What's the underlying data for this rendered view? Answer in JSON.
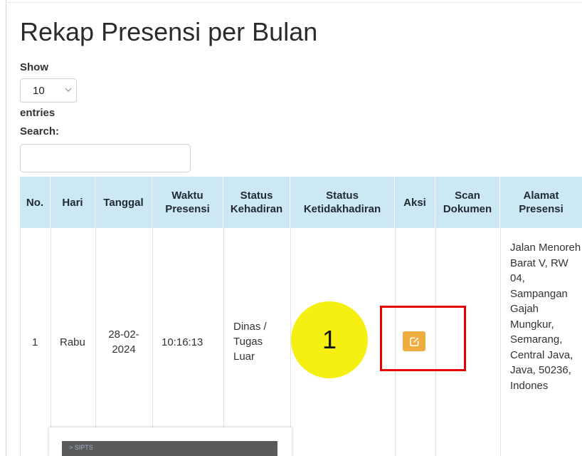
{
  "page": {
    "title": "Rekap Presensi per Bulan"
  },
  "controls": {
    "show_label": "Show",
    "page_size": "10",
    "entries_label": "entries",
    "search_label": "Search:",
    "search_value": ""
  },
  "table": {
    "headers": [
      "No.",
      "Hari",
      "Tanggal",
      "Waktu Presensi",
      "Status Kehadiran",
      "Status Ketidakhadiran",
      "Aksi",
      "Scan Dokumen",
      "Alamat Presensi"
    ],
    "rows": [
      {
        "no": "1",
        "hari": "Rabu",
        "tanggal": "28-02-2024",
        "waktu": "10:16:13",
        "status_kehadiran": "Dinas / Tugas Luar",
        "status_ketidakhadiran": "",
        "scan_dokumen": "",
        "alamat": "Jalan Menoreh Barat V, RW 04, Sampangan Gajah Mungkur, Semarang, Central Java, Java, 50236, Indones"
      }
    ]
  },
  "annotation": {
    "marker_label": "1"
  },
  "popup": {
    "text": "> SIPTS"
  },
  "colors": {
    "header_bg": "#cce8f5",
    "edit_button": "#f0ad3f",
    "highlight_box": "#e60000",
    "marker": "#f5f011"
  },
  "icons": {
    "edit": "edit-icon",
    "dropdown": "chevron-down-icon"
  }
}
